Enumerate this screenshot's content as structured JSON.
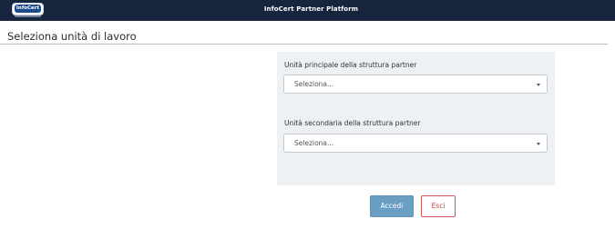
{
  "header": {
    "logo_text": "InfoCert",
    "app_title": "InfoCert Partner Platform"
  },
  "page": {
    "title": "Seleziona unità di lavoro"
  },
  "form": {
    "primary_unit": {
      "label": "Unità principale della struttura partner",
      "value": "Seleziona..."
    },
    "secondary_unit": {
      "label": "Unità secondaria della struttura partner",
      "value": "Seleziona..."
    }
  },
  "actions": {
    "login_label": "Accedi",
    "exit_label": "Esci"
  },
  "colors": {
    "header_bg": "#17243d",
    "panel_bg": "#eef1f4",
    "primary_button": "#6a9ec3",
    "exit_button_text": "#c23b3b"
  },
  "icons": {
    "dropdown": "chevron-down-icon"
  }
}
